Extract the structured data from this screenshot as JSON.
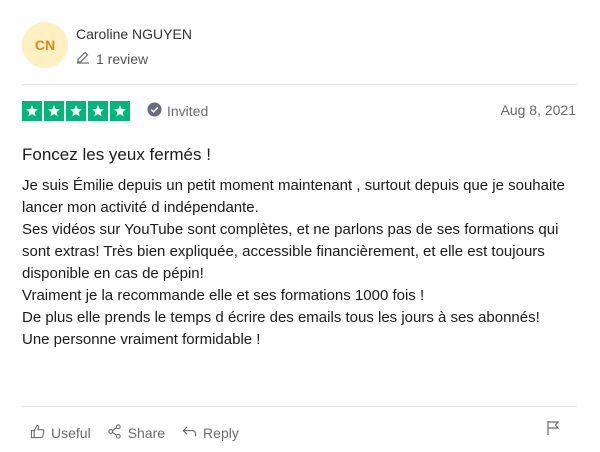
{
  "reviewer": {
    "initials": "CN",
    "name": "Caroline NGUYEN",
    "review_count": "1 review"
  },
  "rating": {
    "stars": 5,
    "max": 5,
    "color": "#00b67a"
  },
  "badge": {
    "label": "Invited"
  },
  "date": "Aug 8, 2021",
  "review": {
    "title": "Foncez les yeux fermés !",
    "lines": [
      "Je suis Émilie depuis un petit moment maintenant , surtout depuis que je souhaite lancer mon activité d indépendante.",
      "Ses vidéos sur YouTube sont complètes, et ne parlons pas de ses formations qui sont extras! Très bien expliquée, accessible financièrement, et elle est toujours disponible en cas de pépin!",
      "Vraiment je la recommande elle et ses formations 1000 fois !",
      "De plus elle prends le temps d écrire des emails tous les jours à ses abonnés!",
      "Une personne vraiment formidable !"
    ]
  },
  "actions": {
    "useful": "Useful",
    "share": "Share",
    "reply": "Reply"
  },
  "icons": {
    "review_count": "pencil-icon",
    "badge": "check-circle-icon",
    "useful": "thumbs-up-icon",
    "share": "share-icon",
    "reply": "reply-icon",
    "flag": "flag-icon"
  },
  "colors": {
    "avatar_bg": "#fff0c2",
    "avatar_text": "#d98b1a",
    "star_green": "#00b67a"
  }
}
